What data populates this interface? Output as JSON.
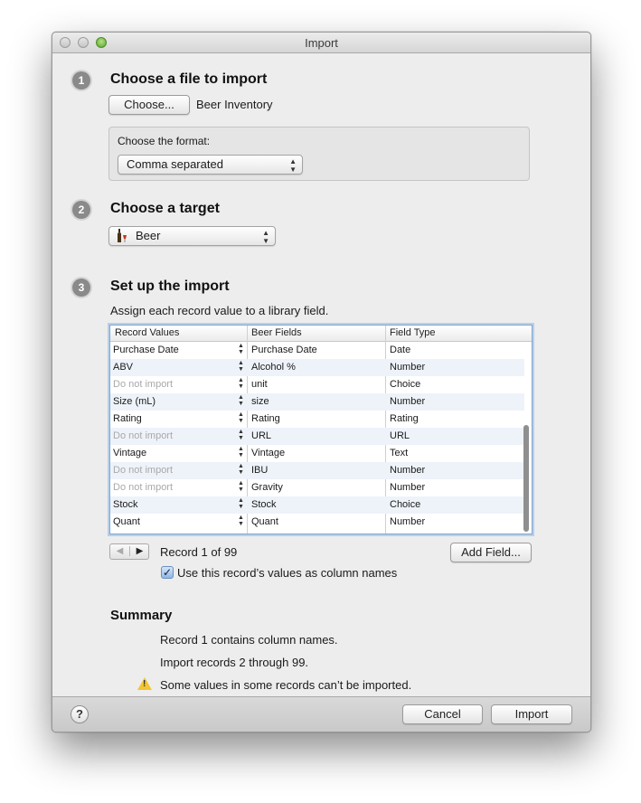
{
  "window": {
    "title": "Import"
  },
  "steps": {
    "one": {
      "num": "1",
      "title": "Choose a file to import",
      "choose_label": "Choose...",
      "file_name": "Beer Inventory",
      "format_label": "Choose the format:",
      "format_value": "Comma separated"
    },
    "two": {
      "num": "2",
      "title": "Choose a target",
      "target_value": "Beer",
      "target_icon": "beer-bottle-icon"
    },
    "three": {
      "num": "3",
      "title": "Set up the import",
      "instruction": "Assign each record value to a library field."
    }
  },
  "table": {
    "headers": [
      "Record Values",
      "Beer Fields",
      "Field Type"
    ],
    "rows": [
      {
        "record": "Purchase Date",
        "field": "Purchase Date",
        "type": "Date",
        "dim": false
      },
      {
        "record": "ABV",
        "field": "Alcohol %",
        "type": "Number",
        "dim": false
      },
      {
        "record": "Do not import",
        "field": "unit",
        "type": "Choice",
        "dim": true
      },
      {
        "record": "Size (mL)",
        "field": "size",
        "type": "Number",
        "dim": false
      },
      {
        "record": "Rating",
        "field": "Rating",
        "type": "Rating",
        "dim": false
      },
      {
        "record": "Do not import",
        "field": "URL",
        "type": "URL",
        "dim": true
      },
      {
        "record": "Vintage",
        "field": "Vintage",
        "type": "Text",
        "dim": false
      },
      {
        "record": "Do not import",
        "field": "IBU",
        "type": "Number",
        "dim": true
      },
      {
        "record": "Do not import",
        "field": "Gravity",
        "type": "Number",
        "dim": true
      },
      {
        "record": "Stock",
        "field": "Stock",
        "type": "Choice",
        "dim": false
      },
      {
        "record": "Quant",
        "field": "Quant",
        "type": "Number",
        "dim": false
      }
    ]
  },
  "record_nav": {
    "status": "Record 1 of 99",
    "add_field_label": "Add Field...",
    "use_names_label": "Use this record’s values as column names",
    "use_names_checked": true
  },
  "summary": {
    "title": "Summary",
    "line1": "Record 1 contains column names.",
    "line2": "Import records 2 through 99.",
    "warning": "Some values in some records can’t be imported."
  },
  "footer": {
    "help_label": "?",
    "cancel_label": "Cancel",
    "import_label": "Import"
  },
  "colors": {
    "accent": "#7fa6d4",
    "alt_row": "#eef3fa",
    "dim_text": "#a9a9a9"
  }
}
